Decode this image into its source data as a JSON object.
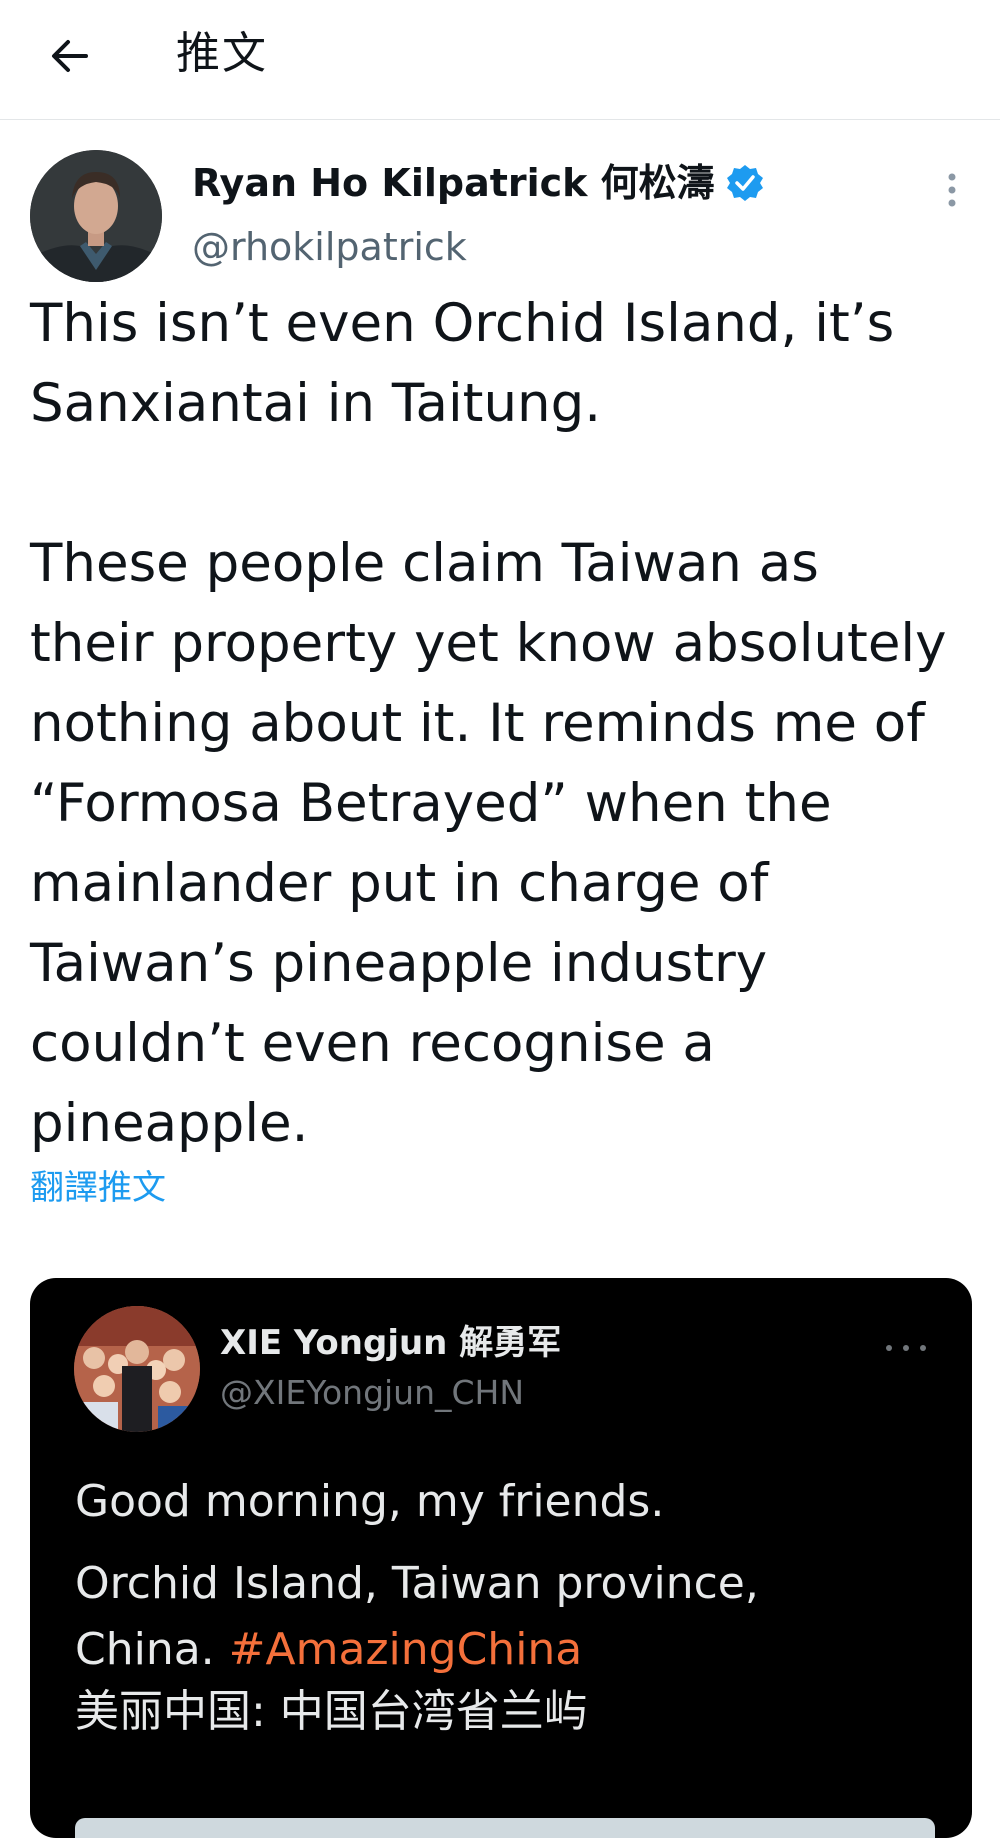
{
  "header": {
    "title": "推文"
  },
  "tweet": {
    "author_name": "Ryan Ho Kilpatrick 何松濤",
    "author_handle": "@rhokilpatrick",
    "body": "This isn’t even Orchid Island, it’s\nSanxiantai in Taitung.\n\nThese people claim Taiwan as\ntheir property yet know absolutely\nnothing about it. It reminds me of\n“Formosa Betrayed” when the\nmainlander put in charge of\nTaiwan’s pineapple industry\ncouldn’t even recognise a\npineapple.",
    "translate_label": "翻譯推文"
  },
  "quoted": {
    "author_name": "XIE Yongjun 解勇军",
    "author_handle": "@XIEYongjun_CHN",
    "line1": "Good morning, my friends.",
    "line2": "Orchid Island, Taiwan province,",
    "line3_prefix": "China. ",
    "hashtag": "#AmazingChina",
    "line4": "美丽中国: 中国台湾省兰屿"
  },
  "icons": {
    "back": "arrow-left-icon",
    "verified": "verified-badge-icon",
    "more": "more-vertical-icon",
    "embed_more": "more-horizontal-icon"
  },
  "colors": {
    "link": "#1d9bf0",
    "verified": "#1d9bf0",
    "hashtag": "#f4703b",
    "embed_bg": "#000000"
  }
}
